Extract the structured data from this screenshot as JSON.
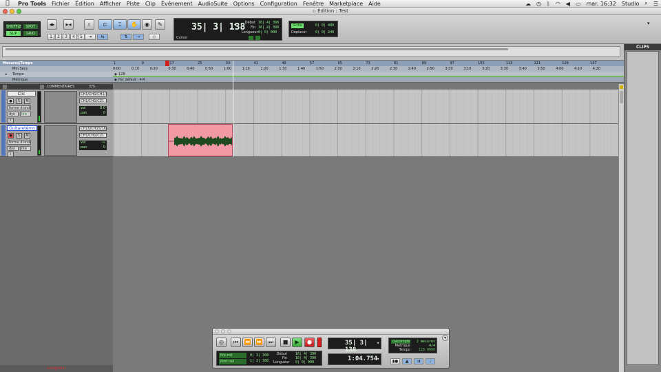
{
  "menubar": {
    "apple": "",
    "app": "Pro Tools",
    "items": [
      "Fichier",
      "Édition",
      "Afficher",
      "Piste",
      "Clip",
      "Événement",
      "AudioSuite",
      "Options",
      "Configuration",
      "Fenêtre",
      "Marketplace",
      "Aide"
    ],
    "clock": "mar. 16:32",
    "user": "Studio"
  },
  "window": {
    "title": "Édition : Test"
  },
  "toolbar": {
    "modes": [
      "SHUFFLE",
      "SPOT",
      "SLIP",
      "GRID"
    ],
    "zoom_presets": [
      "1",
      "2",
      "3",
      "4",
      "5"
    ],
    "counter": {
      "main": "35| 3| 138",
      "cursor_label": "Cursor",
      "debut_label": "Début",
      "fin_label": "Fin",
      "longueur_label": "Longueur",
      "debut": "16| 4| 390",
      "fin": "16| 4| 390",
      "longueur": "0| 0| 000"
    },
    "grid": {
      "grille_label": "Grille",
      "grille": "0| 0| 480",
      "deplacer_label": "Déplacer",
      "deplacer": "0| 0| 240"
    }
  },
  "rulers": {
    "rows": [
      "Mesures|Temps",
      "Min:Secs",
      "Tempo",
      "Métrique"
    ],
    "bars": [
      "1",
      "9",
      "17",
      "25",
      "33",
      "41",
      "49",
      "57",
      "65",
      "73",
      "81",
      "89",
      "97",
      "105",
      "113",
      "121",
      "129",
      "137"
    ],
    "minsecs": [
      "0:00",
      "0:10",
      "0:20",
      "0:30",
      "0:40",
      "0:50",
      "1:00",
      "1:10",
      "1:20",
      "1:30",
      "1:40",
      "1:50",
      "2:00",
      "2:10",
      "2:20",
      "2:30",
      "2:40",
      "2:50",
      "3:00",
      "3:10",
      "3:20",
      "3:30",
      "3:40",
      "3:50",
      "4:00",
      "4:10",
      "4:20"
    ],
    "tempo": "128",
    "meter": "Par défaut : 4/4"
  },
  "track_header": {
    "comments": "COMMENTAIRES",
    "io": "E/S"
  },
  "tracks": [
    {
      "name": "Clic",
      "view": "forme d'onde",
      "dyn": "dyn",
      "read": "lire",
      "in": "CH1/CH1/CH1/2",
      "out": "CH1/CH1/C21",
      "vol_label": "vol",
      "vol": "0.0",
      "pan_label": "pan",
      "pan": "0"
    },
    {
      "name": "Guitaretémn",
      "view": "forme d'onde",
      "dyn": "dyn",
      "read": "lire",
      "in": "CH15/CH15/16",
      "out": "CH1/CH1/C21",
      "vol_label": "vol",
      "vol": "-∞",
      "pan_label": "pan",
      "pan": "0"
    }
  ],
  "clips_panel": {
    "title": "CLIPS"
  },
  "transport": {
    "preroll_label": "Pré-roll",
    "preroll": "0| 3| 308",
    "postroll_label": "Post-roll",
    "postroll": "1| 2| 380",
    "debut_label": "Début",
    "debut": "16| 4| 390",
    "fin_label": "Fin",
    "fin": "16| 4| 390",
    "longueur_label": "Longueur",
    "longueur": "0| 0| 000",
    "main_counter": "35| 3| 138",
    "sub_counter": "1:04.754",
    "decompte_label": "Décompte",
    "decompte": "2 mesures",
    "metrique_label": "Métrique",
    "metrique": "4/4",
    "tempo_label": "Tempo",
    "tempo": "128.0000"
  },
  "status": {
    "text": "enregistrer"
  },
  "colors": {
    "clip": "#f19aa6",
    "lcd_text": "#8ef08a",
    "record": "#e02020",
    "play": "#4cc94c"
  }
}
